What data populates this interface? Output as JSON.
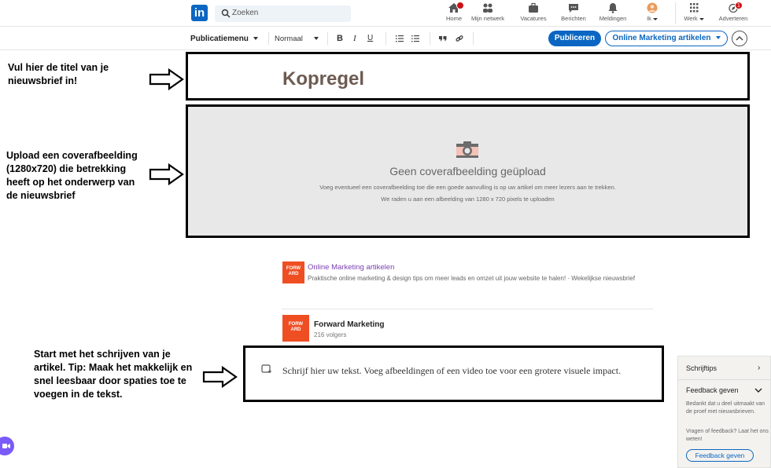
{
  "nav": {
    "logo": "in",
    "search_placeholder": "Zoeken",
    "items": [
      {
        "label": "Home",
        "icon": "home-icon"
      },
      {
        "label": "Mijn netwerk",
        "icon": "network-icon"
      },
      {
        "label": "Vacatures",
        "icon": "briefcase-icon"
      },
      {
        "label": "Berichten",
        "icon": "messaging-icon"
      },
      {
        "label": "Meldingen",
        "icon": "bell-icon"
      },
      {
        "label": "Ik",
        "icon": "avatar-icon"
      },
      {
        "label": "Werk",
        "icon": "grid-icon"
      },
      {
        "label": "Adverteren",
        "icon": "compass-icon"
      }
    ],
    "ad_badge": "1"
  },
  "toolbar": {
    "menu_label": "Publicatiemenu",
    "style_label": "Normaal",
    "bold": "B",
    "italic": "I",
    "underline": "U",
    "publish_label": "Publiceren",
    "newsletter_label": "Online Marketing artikelen"
  },
  "editor": {
    "title_placeholder": "Kopregel",
    "cover_title": "Geen coverafbeelding geüpload",
    "cover_sub1": "Voeg eventueel een coverafbeelding toe die een goede aanvulling is op uw artikel om meer lezers aan te trekken.",
    "cover_sub2": "We raden u aan een afbeelding van 1280 x 720 pixels te uploaden",
    "body_placeholder": "Schrijf hier uw tekst. Voeg afbeeldingen of een video toe voor een grotere visuele impact."
  },
  "newsletter": {
    "logo_text": "FORW ARD",
    "name": "Online Marketing artikelen",
    "description": "Praktische online marketing & design tips om meer leads en omzet uit jouw website te halen! · Wekelijkse nieuwsbrief"
  },
  "author": {
    "logo_text": "FORW ARD",
    "name": "Forward Marketing",
    "followers": "216 volgers"
  },
  "annotations": {
    "title_hint": "Vul hier de titel van je nieuwsbrief in!",
    "cover_hint": "Upload een coverafbeelding (1280x720) die betrekking heeft op het onderwerp van de nieuwsbrief",
    "body_hint": "Start met het schrijven van je artikel. Tip: Maak het makkelijk en snel leesbaar door spaties toe te voegen in de tekst."
  },
  "side_panel": {
    "tips_label": "Schrijftips",
    "feedback_heading": "Feedback geven",
    "thanks_text": "Bedankt dat u deel uitmaakt van de proef met nieuwsbrieven.",
    "question_text": "Vragen of feedback? Laat het ons weten!",
    "feedback_button": "Feedback geven"
  },
  "colors": {
    "brand": "#0a66c2",
    "forward_orange": "#ef4e23",
    "newsletter_purple": "#7b3fb3"
  }
}
